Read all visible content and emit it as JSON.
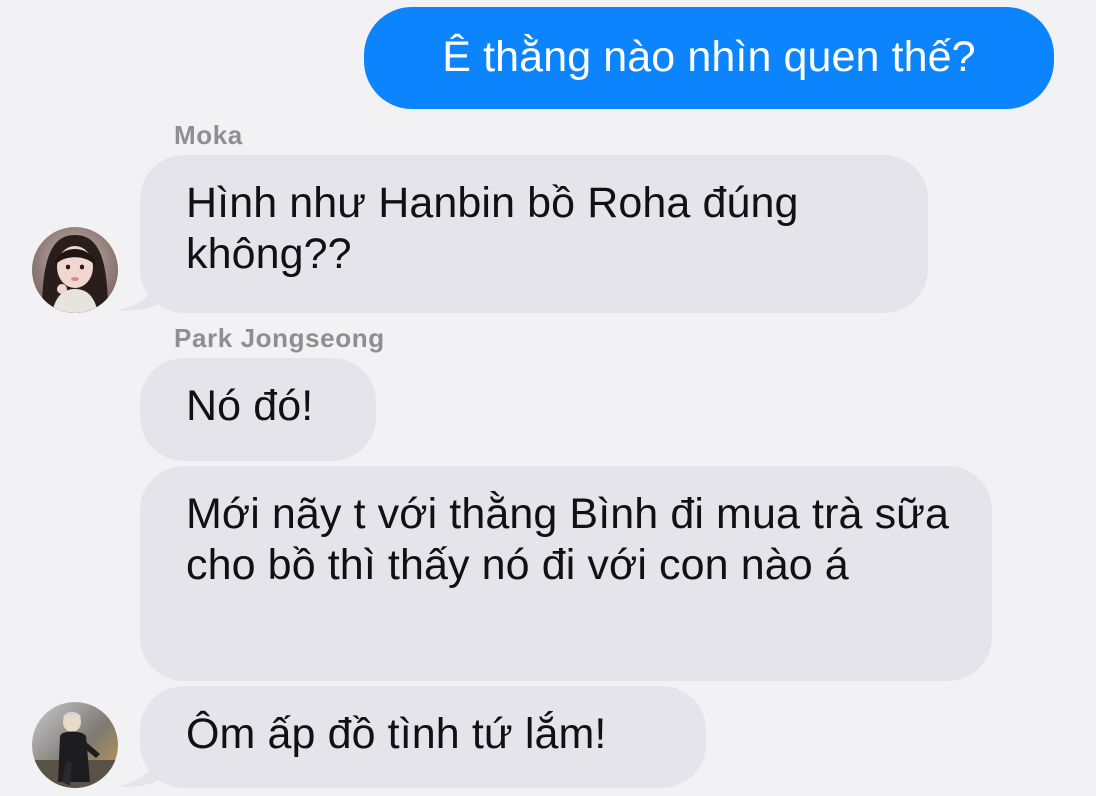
{
  "conversation": {
    "outgoing_1": "Ê thằng nào nhìn quen thế?",
    "sender_moka": "Moka",
    "moka_message": "Hình như Hanbin bồ Roha đúng không??",
    "sender_park": "Park Jongseong",
    "park_message_1": "Nó đó!",
    "park_message_2": "Mới nãy t với thằng Bình đi mua trà sữa cho bồ thì thấy nó đi với con nào á",
    "park_message_3": "Ôm ấp đồ tình tứ lắm!"
  },
  "colors": {
    "background": "#f2f2f4",
    "incoming_bubble": "#e5e4ea",
    "outgoing_bubble": "#0b84fe",
    "sender_name": "#8e8e93"
  },
  "icons": {
    "moka_avatar": "user-avatar-photo",
    "park_avatar": "user-avatar-photo"
  }
}
